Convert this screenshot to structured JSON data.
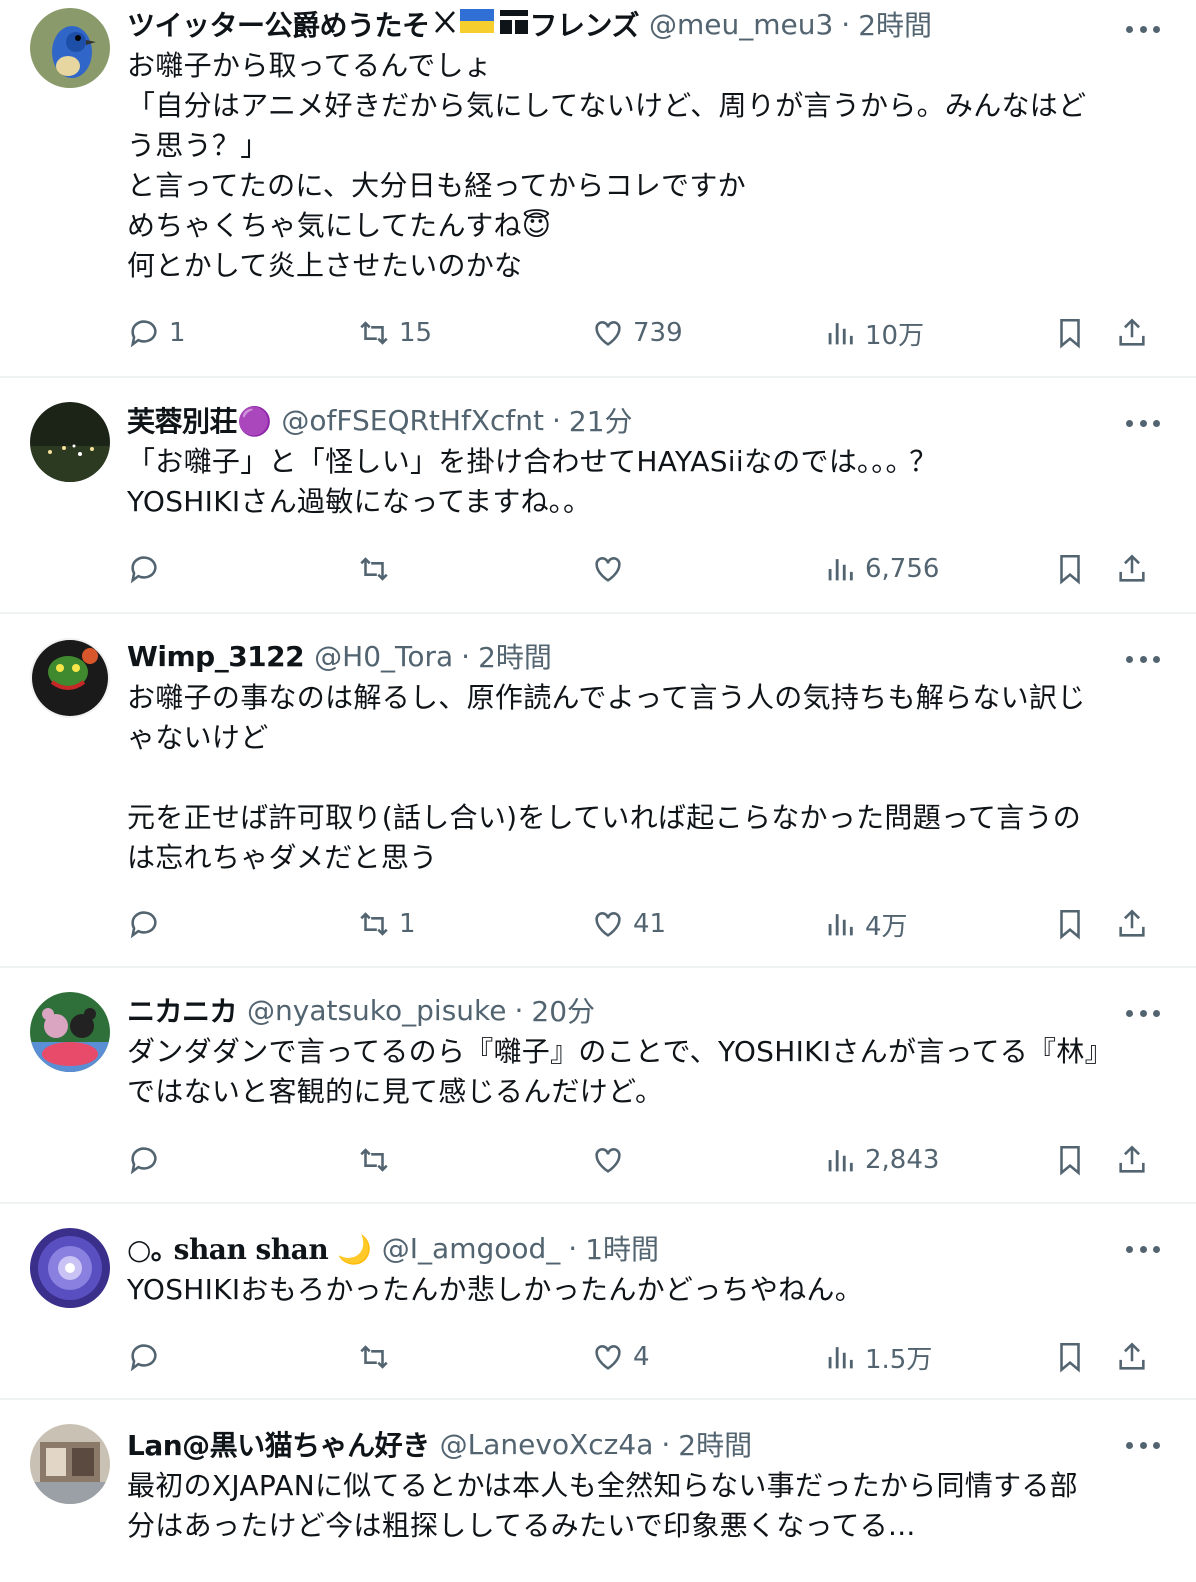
{
  "tweets": [
    {
      "name": "ツイッター公爵めうたそ",
      "badges": [
        "x-logo",
        "ukraine-flag"
      ],
      "name_suffix": "フレンズ",
      "handle": "@meu_meu3",
      "time": "2時間",
      "sep": "·",
      "text": "お囃子から取ってるんでしょ\n「自分はアニメ好きだから気にしてないけど、周りが言うから。みんなはど\nう思う？」\nと言ってたのに、大分日も経ってからコレですか\nめちゃくちゃ気にしてたんすね😇\n何とかして炎上させたいのかな",
      "replies": "1",
      "retweets": "15",
      "likes": "739",
      "views": "10万"
    },
    {
      "name": "芙蓉別荘🟣",
      "handle": "@ofFSEQRtHfXcfnt",
      "time": "21分",
      "sep": "·",
      "text": "「お囃子」と「怪しい」を掛け合わせてHAYASiiなのでは｡｡｡ ？\nYOSHIKIさん過敏になってますね｡｡",
      "replies": "",
      "retweets": "",
      "likes": "",
      "views": "6,756"
    },
    {
      "name": "Wimp_3122",
      "handle": "@H0_Tora",
      "time": "2時間",
      "sep": "·",
      "text": "お囃子の事なのは解るし、原作読んでよって言う人の気持ちも解らない訳じ\nゃないけど\n\n元を正せば許可取り(話し合い)をしていれば起こらなかった問題って言うの\nは忘れちゃダメだと思う",
      "replies": "",
      "retweets": "1",
      "likes": "41",
      "views": "4万"
    },
    {
      "name": "ニカニカ",
      "handle": "@nyatsuko_pisuke",
      "time": "20分",
      "sep": "·",
      "text": "ダンダダンで言ってるのら『囃子』のことで、YOSHIKIさんが言ってる『林』\nではないと客観的に見て感じるんだけど。",
      "replies": "",
      "retweets": "",
      "likes": "",
      "views": "2,843"
    },
    {
      "name": "○｡ shan shan 🌙",
      "handle": "@I_amgood_",
      "time": "1時間",
      "sep": "·",
      "text": "YOSHIKIおもろかったんか悲しかったんかどっちやねん。",
      "replies": "",
      "retweets": "",
      "likes": "4",
      "views": "1.5万"
    },
    {
      "name": "Lan@黒い猫ちゃん好き",
      "handle": "@LanevoXcz4a",
      "time": "2時間",
      "sep": "·",
      "text": "最初のXJAPANに似てるとかは本人も全然知らない事だったから同情する部\n分はあったけど今は粗探ししてるみたいで印象悪くなってる...",
      "replies": "",
      "retweets": "",
      "likes": "",
      "views": ""
    }
  ],
  "colors": {
    "text": "#0f1419",
    "secondary": "#536471",
    "divider": "#eff3f4"
  },
  "icons": [
    "reply-icon",
    "retweet-icon",
    "like-icon",
    "views-icon",
    "bookmark-icon",
    "share-icon",
    "more-icon"
  ]
}
